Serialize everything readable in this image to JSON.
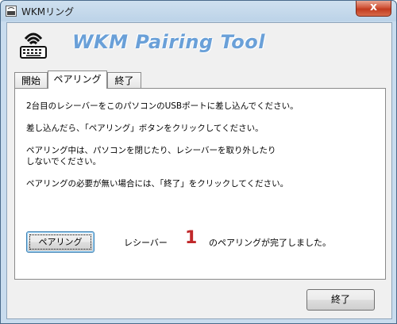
{
  "window": {
    "title": "WKMリング",
    "close_glyph": "x",
    "app_icon": "keyboard-icon"
  },
  "header": {
    "title": "WKM Pairing Tool",
    "logo_icon": "wireless-keyboard-icon",
    "title_color": "#6aa0d8"
  },
  "tabs": [
    {
      "label": "開始",
      "active": false
    },
    {
      "label": "ペアリング",
      "active": true
    },
    {
      "label": "終了",
      "active": false
    }
  ],
  "panel": {
    "instructions": [
      "2台目のレシーバーをこのパソコンのUSBポートに差し込んでください。",
      "差し込んだら、「ペアリング」ボタンをクリックしてください。",
      "ペアリング中は、パソコンを閉じたり、レシーバーを取り外したり",
      "しないでください。",
      "ペアリングの必要が無い場合には、「終了」をクリックしてください。"
    ],
    "pair_button": "ペアリング",
    "receiver_label": "レシーバー",
    "receiver_number": "1",
    "receiver_number_color": "#c0282a",
    "status_text": "のペアリングが完了しました。"
  },
  "footer": {
    "exit_button": "終了"
  }
}
